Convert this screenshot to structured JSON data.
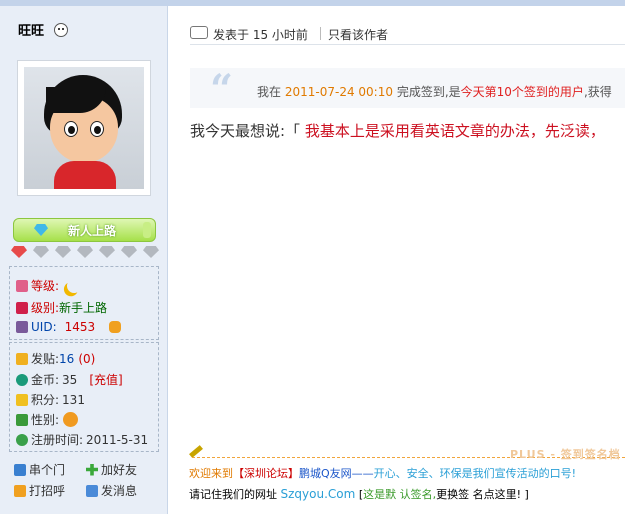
{
  "user": {
    "name": "旺旺",
    "rank_title": "新人上路",
    "level_label": "等级:",
    "group_label": "级别:",
    "group_value": "新手上路",
    "uid_label": "UID:",
    "uid_value": "1453",
    "posts_label": "发贴:",
    "posts_value": "16",
    "posts_extra": "(0)",
    "coins_label": "金币:",
    "coins_value": "35",
    "recharge_label": "[充值]",
    "points_label": "积分:",
    "points_value": "131",
    "gender_label": "性别:",
    "register_label": "注册时间:",
    "register_value": "2011-5-31"
  },
  "actions": {
    "visit": "串个门",
    "add_friend": "加好友",
    "greet": "打招呼",
    "message": "发消息"
  },
  "post_header": {
    "posted_time": "发表于 15 小时前",
    "only_author": "只看该作者"
  },
  "checkin_quote": {
    "prefix": "我在",
    "datetime": "2011-07-24 00:10",
    "middle": "完成签到,是",
    "today": "今天",
    "rank_part": "第10个签到的用户",
    "suffix": ",获得"
  },
  "content": {
    "prefix": "我今天最想说:「",
    "text": "我基本上是采用看英语文章的办法，先泛读，"
  },
  "signature": {
    "plus_logo": "PLUS - 签到签名档",
    "welcome": "欢迎来到",
    "forum_name": "【深圳论坛】",
    "site_name": "鹏城Q友网——",
    "slogan_part": "开心、安全、环保是我们宣传活动的口号!",
    "remember": "请记住我们的网址",
    "url": "Szqyou.Com",
    "bracket_open": "[",
    "default_label": "这是默 认签名,",
    "change_text": "更换签 名点这里!",
    "bracket_close": " ]"
  },
  "colors": {
    "sidebar_bg": "#e8eef7",
    "rank_green": "#a6e04a",
    "accent_orange": "#e07a00",
    "accent_red": "#cc0000"
  }
}
